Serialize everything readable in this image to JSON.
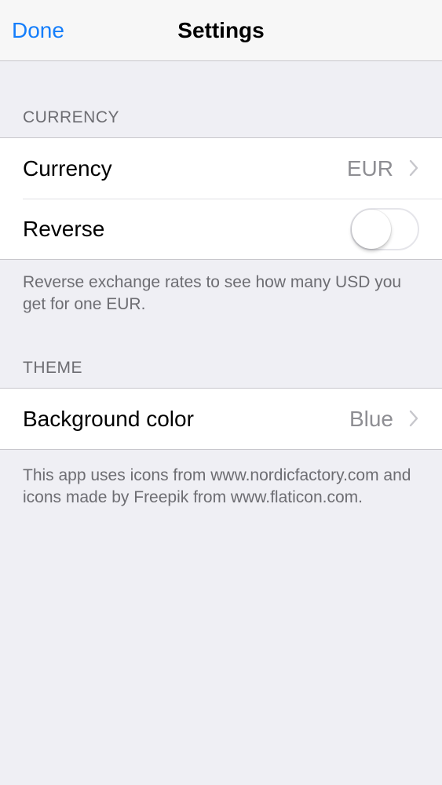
{
  "navbar": {
    "done_label": "Done",
    "title": "Settings"
  },
  "currency_section": {
    "header": "CURRENCY",
    "currency_row": {
      "label": "Currency",
      "value": "EUR",
      "icon": "chevron-right-icon"
    },
    "reverse_row": {
      "label": "Reverse",
      "toggle_on": false
    },
    "footer": "Reverse exchange rates to see how many USD you get for one EUR."
  },
  "theme_section": {
    "header": "THEME",
    "background_row": {
      "label": "Background color",
      "value": "Blue",
      "icon": "chevron-right-icon"
    },
    "footer": "This app uses icons from www.nordicfactory.com and icons made by Freepik from www.flaticon.com."
  },
  "colors": {
    "accent": "#147efb",
    "background": "#efeff4",
    "secondary_text": "#8e8e93",
    "section_text": "#6d6d72"
  }
}
